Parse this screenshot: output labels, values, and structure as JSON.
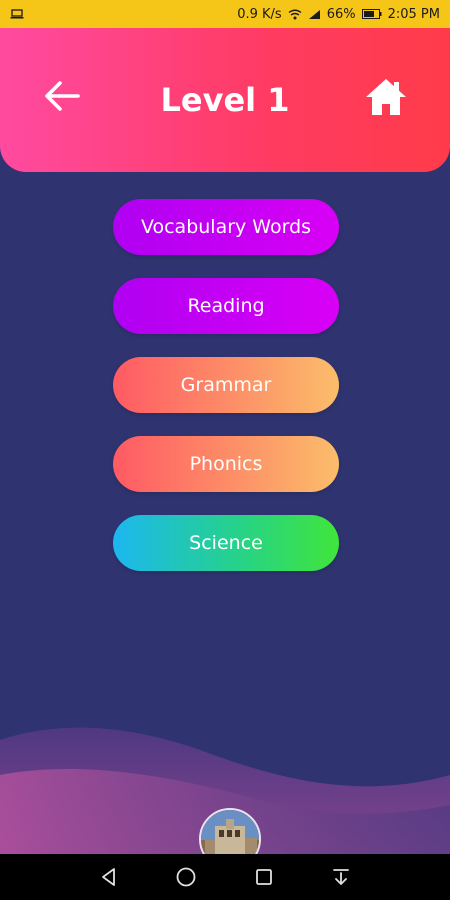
{
  "status_bar": {
    "left_icon": "laptop-icon",
    "speed": "0.9 K/s",
    "battery": "66%",
    "time": "2:05 PM",
    "bg_color": "#f5c518"
  },
  "header": {
    "title": "Level 1",
    "back_icon": "arrow-left-icon",
    "home_icon": "home-icon",
    "gradient_start": "#ff4aa0",
    "gradient_end": "#ff3b4a"
  },
  "menu": {
    "items": [
      {
        "label": "Vocabulary Words",
        "style": "purple"
      },
      {
        "label": "Reading",
        "style": "purple"
      },
      {
        "label": "Grammar",
        "style": "orange"
      },
      {
        "label": "Phonics",
        "style": "orange"
      },
      {
        "label": "Science",
        "style": "green"
      }
    ]
  },
  "bottom": {
    "avatar_icon": "avatar"
  },
  "nav_bar": {
    "back_icon": "nav-back-icon",
    "home_icon": "nav-home-icon",
    "recents_icon": "nav-recents-icon",
    "notification_icon": "nav-pulldown-icon"
  },
  "colors": {
    "background": "#2f3470"
  }
}
